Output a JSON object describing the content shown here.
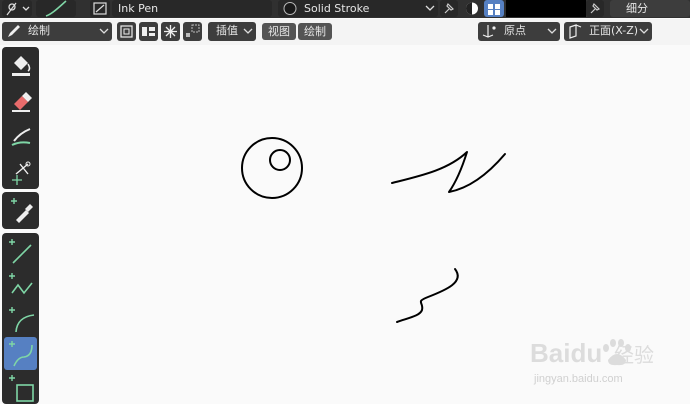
{
  "topbar": {
    "brush_name": "Ink Pen",
    "material_name": "Solid Stroke",
    "subdivide_label": "细分"
  },
  "header": {
    "mode_label": "绘制",
    "interpolate_label": "插值",
    "view_menu": "视图",
    "draw_menu": "绘制",
    "pivot_label": "原点",
    "orientation_label": "正面(X-Z)"
  },
  "toolbar": {
    "tools": [
      {
        "name": "fill-tool",
        "icon": "paint-bucket-icon"
      },
      {
        "name": "erase-tool",
        "icon": "eraser-icon"
      },
      {
        "name": "tint-tool",
        "icon": "brush-icon"
      },
      {
        "name": "cutter-tool",
        "icon": "scissors-icon"
      },
      {
        "name": "eyedropper-tool",
        "icon": "eyedropper-icon"
      },
      {
        "name": "line-tool",
        "icon": "line-icon"
      },
      {
        "name": "polyline-tool",
        "icon": "polyline-icon"
      },
      {
        "name": "arc-tool",
        "icon": "arc-icon"
      },
      {
        "name": "curve-tool",
        "icon": "curve-icon",
        "active": true
      },
      {
        "name": "box-tool",
        "icon": "box-icon"
      }
    ]
  },
  "colors": {
    "header_bg": "#303030",
    "button_bg": "#545454",
    "active_tool": "#5680c2",
    "canvas_bg": "#fafafa",
    "stroke": "#000000"
  },
  "watermark": {
    "brand": "Baidu",
    "brand_cn": "经验",
    "url": "jingyan.baidu.com"
  }
}
